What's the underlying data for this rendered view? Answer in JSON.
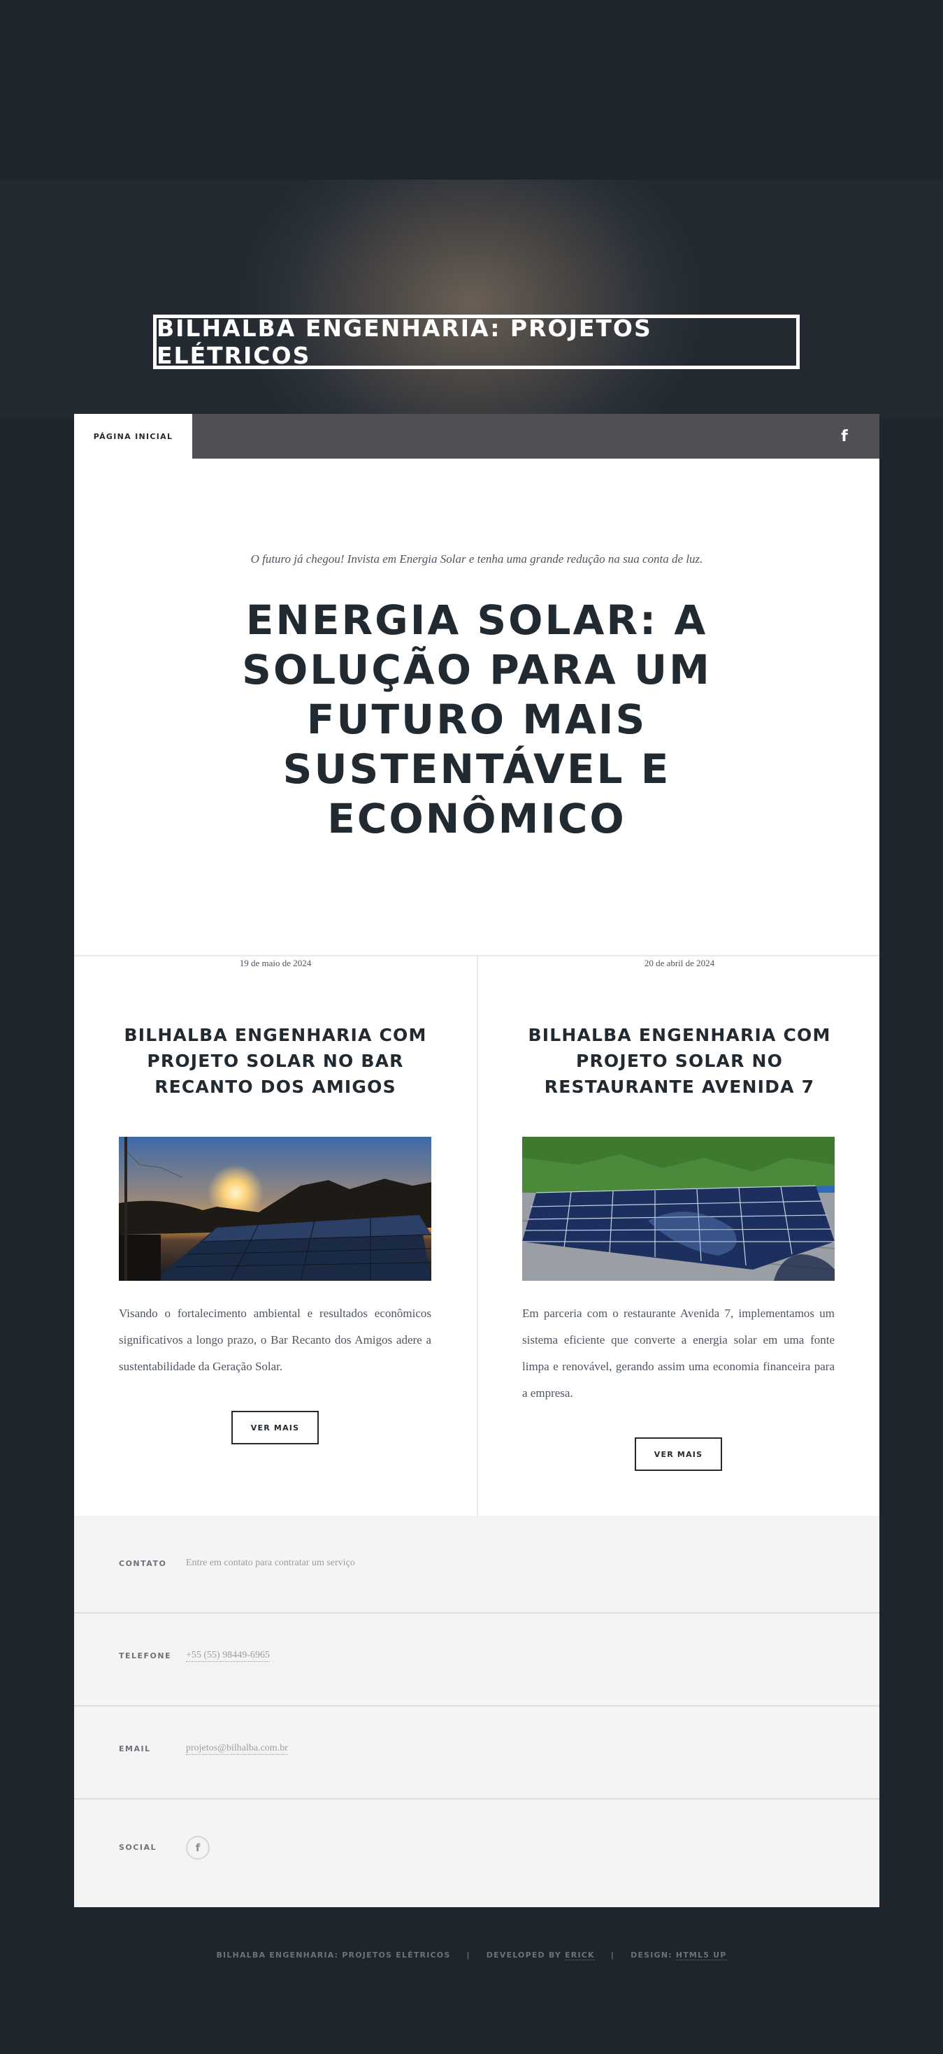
{
  "header": {
    "site_title": "BILHALBA ENGENHARIA: PROJETOS ELÉTRICOS"
  },
  "nav": {
    "home_label": "PÁGINA INICIAL",
    "social_icon": "facebook-icon"
  },
  "featured": {
    "intro": "O futuro já chegou! Invista em Energia Solar e tenha uma grande redução na sua conta de luz.",
    "title": "ENERGIA SOLAR: A SOLUÇÃO PARA UM FUTURO MAIS SUSTENTÁVEL E ECONÔMICO"
  },
  "posts": [
    {
      "date": "19 de maio de 2024",
      "title": "BILHALBA ENGENHARIA COM PROJETO SOLAR NO BAR RECANTO DOS AMIGOS",
      "text": "Visando o fortalecimento ambiental e resultados econômicos significativos a longo prazo, o Bar Recanto dos Amigos adere a sustentabilidade da Geração Solar.",
      "button": "VER MAIS"
    },
    {
      "date": "20 de abril de 2024",
      "title": "BILHALBA ENGENHARIA COM PROJETO SOLAR NO RESTAURANTE AVENIDA 7",
      "text": "Em parceria com o restaurante Avenida 7, implementamos um sistema eficiente que converte a energia solar em uma fonte limpa e renovável, gerando assim uma economia financeira para a empresa.",
      "button": "VER MAIS"
    }
  ],
  "contact": {
    "contato_label": "CONTATO",
    "contato_value": "Entre em contato para contratar um serviço",
    "telefone_label": "TELEFONE",
    "telefone_value": "+55 (55) 98449-6965",
    "email_label": "EMAIL",
    "email_value": "projetos@bilhalba.com.br",
    "social_label": "SOCIAL",
    "social_icon": "facebook-icon"
  },
  "footer": {
    "copyright": "BILHALBA ENGENHARIA: PROJETOS ELÉTRICOS",
    "developed_prefix": "DEVELOPED BY",
    "developed_name": "ERICK",
    "design_prefix": "DESIGN:",
    "design_name": "HTML5 UP"
  },
  "colors": {
    "background": "#1e252d",
    "text_dark": "#212931",
    "nav_bar": "#4f5154",
    "contact_bg": "#f4f4f4"
  }
}
